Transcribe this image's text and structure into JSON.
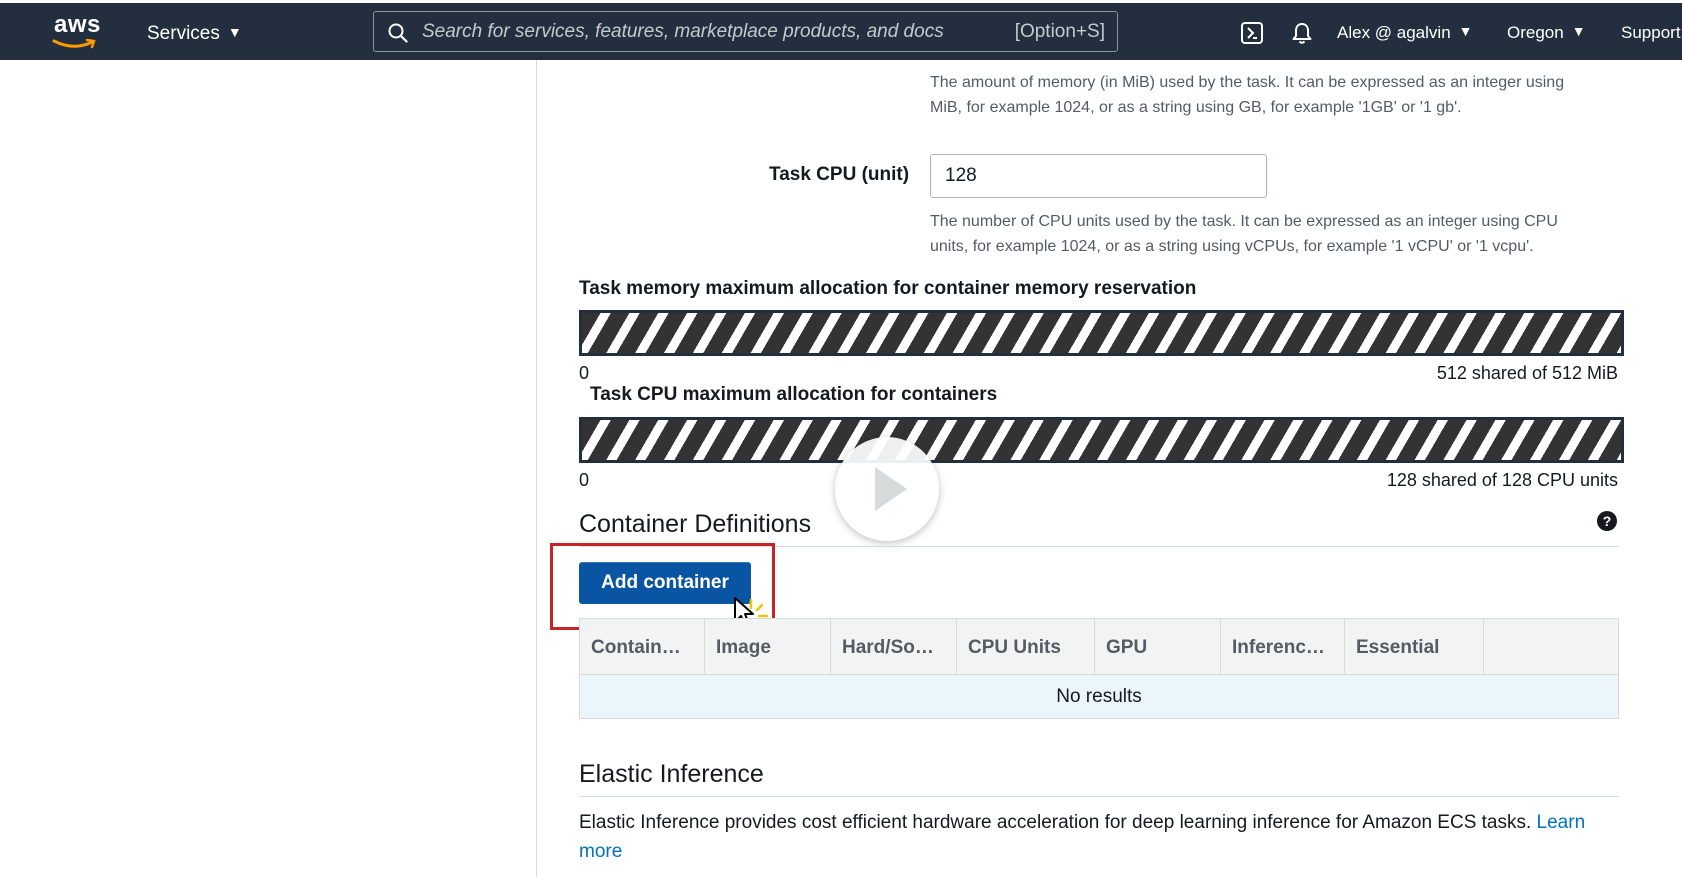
{
  "topbar": {
    "logo_text": "aws",
    "services_label": "Services",
    "search_placeholder": "Search for services, features, marketplace products, and docs",
    "search_shortcut": "[Option+S]",
    "account_label": "Alex @ agalvin",
    "region_label": "Oregon",
    "support_label": "Support"
  },
  "memory": {
    "hint": "The amount of memory (in MiB) used by the task. It can be expressed as an integer using MiB, for example 1024, or as a string using GB, for example '1GB' or '1 gb'."
  },
  "cpu": {
    "label": "Task CPU (unit)",
    "value": "128",
    "hint": "The number of CPU units used by the task. It can be expressed as an integer using CPU units, for example 1024, or as a string using vCPUs, for example '1 vCPU' or '1 vcpu'."
  },
  "memory_allocation": {
    "title": "Task memory maximum allocation for container memory reservation",
    "min": "0",
    "max_text": "512 shared of 512 MiB",
    "fill_fraction": 1.0
  },
  "cpu_allocation": {
    "title": "Task CPU maximum allocation for containers",
    "min": "0",
    "max_text": "128 shared of 128 CPU units",
    "fill_fraction": 1.0
  },
  "container_definitions": {
    "title": "Container Definitions",
    "help": "?",
    "add_button": "Add container",
    "columns": [
      "Contain…",
      "Image",
      "Hard/So…",
      "CPU Units",
      "GPU",
      "Inferenc…",
      "Essential",
      ""
    ],
    "empty_text": "No results"
  },
  "elastic_inference": {
    "title": "Elastic Inference",
    "text": "Elastic Inference provides cost efficient hardware acceleration for deep learning inference for Amazon ECS tasks. ",
    "link": "Learn more"
  },
  "colors": {
    "topbar": "#232f3e",
    "primary_button": "#0a55a3",
    "highlight": "#c7242a",
    "link": "#0073bb",
    "empty_row": "#eaf6fc"
  },
  "icons": [
    "aws-logo-icon",
    "search-icon",
    "cloudshell-icon",
    "bell-icon",
    "help-icon",
    "play-icon",
    "cursor-icon"
  ]
}
